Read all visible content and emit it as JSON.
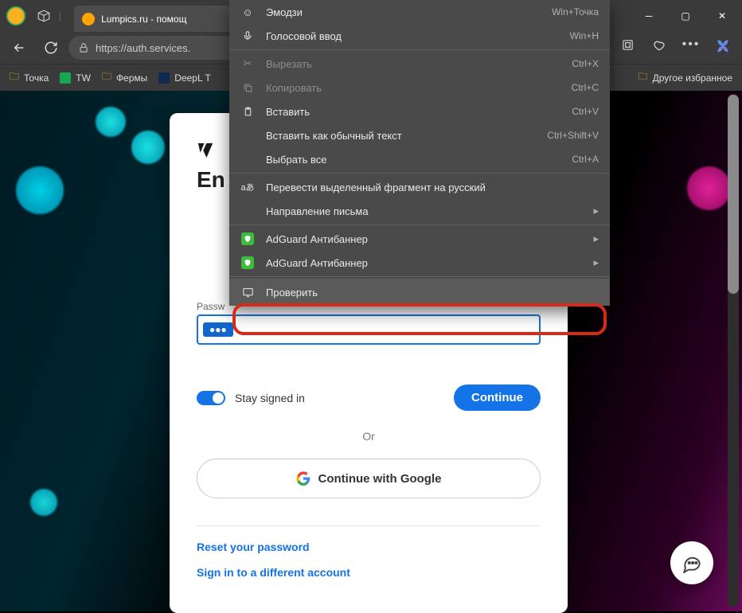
{
  "titlebar": {
    "tab_title": "Lumpics.ru - помощ"
  },
  "toolbar": {
    "url": "https://auth.services."
  },
  "bookmarks": {
    "items": [
      "Точка",
      "TW",
      "Фермы",
      "DeepL Т"
    ],
    "other": "Другое избранное"
  },
  "card": {
    "heading_prefix": "En",
    "pw_label": "Passw",
    "pw_value": "●●●",
    "stay_label": "Stay signed in",
    "continue_label": "Continue",
    "or_label": "Or",
    "google_label": "Continue with Google",
    "reset_link": "Reset your password",
    "diff_link": "Sign in to a different account"
  },
  "ctx": {
    "emoji": {
      "label": "Эмодзи",
      "shortcut": "Win+Точка"
    },
    "voice": {
      "label": "Голосовой ввод",
      "shortcut": "Win+H"
    },
    "cut": {
      "label": "Вырезать",
      "shortcut": "Ctrl+X"
    },
    "copy": {
      "label": "Копировать",
      "shortcut": "Ctrl+C"
    },
    "paste": {
      "label": "Вставить",
      "shortcut": "Ctrl+V"
    },
    "paste_plain": {
      "label": "Вставить как обычный текст",
      "shortcut": "Ctrl+Shift+V"
    },
    "select_all": {
      "label": "Выбрать все",
      "shortcut": "Ctrl+A"
    },
    "translate": {
      "label": "Перевести выделенный фрагмент на русский"
    },
    "direction": {
      "label": "Направление письма"
    },
    "adguard1": {
      "label": "AdGuard Антибаннер"
    },
    "adguard2": {
      "label": "AdGuard Антибаннер"
    },
    "inspect": {
      "label": "Проверить"
    }
  }
}
